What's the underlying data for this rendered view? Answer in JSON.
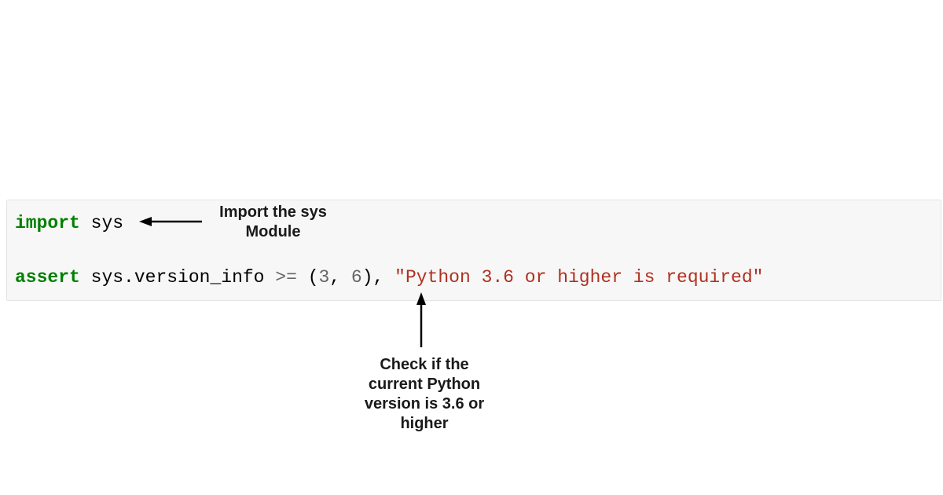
{
  "code": {
    "line1": {
      "kw": "import",
      "sp": " ",
      "module": "sys"
    },
    "line2": {
      "kw": "assert",
      "sp1": " ",
      "expr": "sys.version_info ",
      "op": ">=",
      "sp2": " (",
      "n1": "3",
      "comma": ", ",
      "n2": "6",
      "close": "), ",
      "str": "\"Python 3.6 or higher is required\""
    }
  },
  "annotations": {
    "top": {
      "l1": "Import the sys",
      "l2": "Module"
    },
    "bottom": {
      "l1": "Check if the",
      "l2": "current Python",
      "l3": "version is 3.6 or",
      "l4": "higher"
    }
  }
}
